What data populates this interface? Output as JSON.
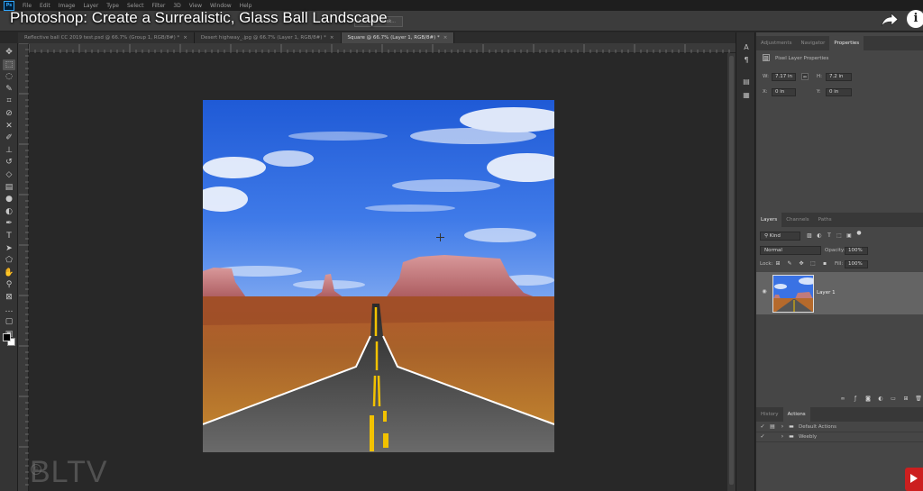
{
  "video": {
    "title": "Photoshop: Create a Surrealistic, Glass Ball Landscape",
    "watermark": "BLTV",
    "watermark_mark": "©",
    "info_glyph": "i"
  },
  "menu": [
    "File",
    "Edit",
    "Image",
    "Layer",
    "Type",
    "Select",
    "Filter",
    "3D",
    "View",
    "Window",
    "Help"
  ],
  "ps_logo": "Ps",
  "options_bar": {
    "mask_button": "ect and Mask..."
  },
  "tabs": [
    {
      "label": "Reflective ball CC 2019 test.psd @ 66.7% (Group 1, RGB/8#) *",
      "close": "×",
      "active": false
    },
    {
      "label": "Desert highway_.jpg @ 66.7% (Layer 1, RGB/8#) *",
      "close": "×",
      "active": false
    },
    {
      "label": "Square @ 66.7% (Layer 1, RGB/8#) *",
      "close": "×",
      "active": true
    }
  ],
  "tools": [
    {
      "name": "move-tool",
      "icon": "move-icon",
      "glyph": "✥"
    },
    {
      "name": "marquee-tool",
      "icon": "marquee-icon",
      "glyph": "⬚"
    },
    {
      "name": "lasso-tool",
      "icon": "lasso-icon",
      "glyph": "◌"
    },
    {
      "name": "quick-select-tool",
      "icon": "quick-select-icon",
      "glyph": "✎"
    },
    {
      "name": "crop-tool",
      "icon": "crop-icon",
      "glyph": "⌗"
    },
    {
      "name": "eyedropper-tool",
      "icon": "eyedropper-icon",
      "glyph": "⊘"
    },
    {
      "name": "healing-tool",
      "icon": "bandage-icon",
      "glyph": "✕"
    },
    {
      "name": "brush-tool",
      "icon": "brush-icon",
      "glyph": "✐"
    },
    {
      "name": "clone-stamp-tool",
      "icon": "stamp-icon",
      "glyph": "⊥"
    },
    {
      "name": "history-brush-tool",
      "icon": "history-brush-icon",
      "glyph": "↺"
    },
    {
      "name": "eraser-tool",
      "icon": "eraser-icon",
      "glyph": "◇"
    },
    {
      "name": "gradient-tool",
      "icon": "gradient-icon",
      "glyph": "▤"
    },
    {
      "name": "blur-tool",
      "icon": "droplet-icon",
      "glyph": "●"
    },
    {
      "name": "dodge-tool",
      "icon": "dodge-icon",
      "glyph": "◐"
    },
    {
      "name": "pen-tool",
      "icon": "pen-icon",
      "glyph": "✒"
    },
    {
      "name": "type-tool",
      "icon": "type-icon",
      "glyph": "T"
    },
    {
      "name": "path-select-tool",
      "icon": "arrow-icon",
      "glyph": "➤"
    },
    {
      "name": "shape-tool",
      "icon": "shape-icon",
      "glyph": "⬠"
    },
    {
      "name": "hand-tool",
      "icon": "hand-icon",
      "glyph": "✋"
    },
    {
      "name": "zoom-tool",
      "icon": "zoom-icon",
      "glyph": "⚲"
    },
    {
      "name": "frame-tool",
      "icon": "frame-icon",
      "glyph": "⊠"
    },
    {
      "name": "more-tools",
      "icon": "more-icon",
      "glyph": "…"
    },
    {
      "name": "quick-mask",
      "icon": "quick-mask-icon",
      "glyph": "▢"
    },
    {
      "name": "screen-mode",
      "icon": "screen-mode-icon",
      "glyph": "▣"
    }
  ],
  "properties_panel": {
    "tabs": [
      "Adjustments",
      "Navigator",
      "Properties"
    ],
    "active_tab": "Properties",
    "header": "Pixel Layer Properties",
    "w_label": "W:",
    "w_value": "7.17 in",
    "h_label": "H:",
    "h_value": "7.2 in",
    "x_label": "X:",
    "x_value": "0 in",
    "y_label": "Y:",
    "y_value": "0 in"
  },
  "layers_panel": {
    "tabs": [
      "Layers",
      "Channels",
      "Paths"
    ],
    "active_tab": "Layers",
    "filter": "Kind",
    "blend_mode": "Normal",
    "opacity_label": "Opacity:",
    "opacity": "100%",
    "lock_label": "Lock:",
    "fill_label": "Fill:",
    "fill": "100%",
    "layers": [
      {
        "name": "Layer 1",
        "visible": true
      }
    ]
  },
  "actions_panel": {
    "tabs": [
      "History",
      "Actions"
    ],
    "active_tab": "Actions",
    "items": [
      "Default Actions",
      "Weebly"
    ]
  },
  "colors": {
    "accent": "#31a8ff",
    "panel_bg": "#464646",
    "canvas_bg": "#282828",
    "subscribe_red": "#cc1f1f"
  }
}
